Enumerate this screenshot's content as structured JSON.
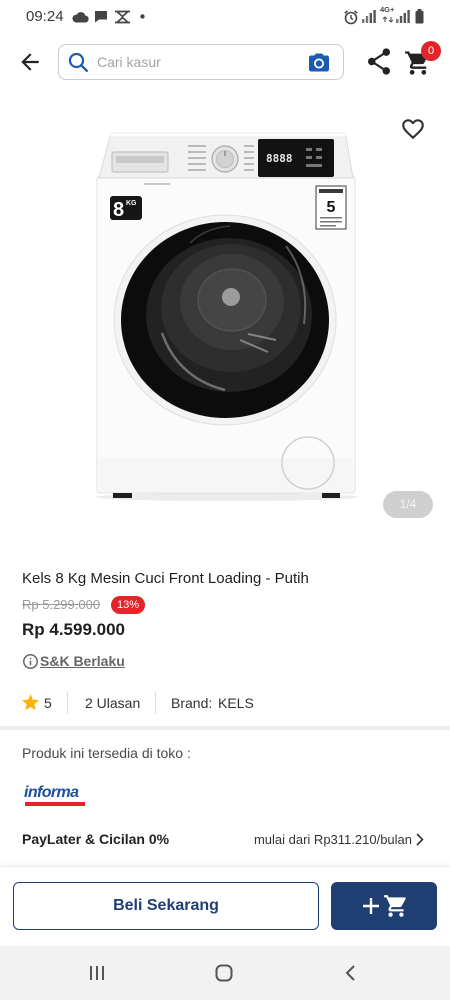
{
  "status_bar": {
    "time": "09:24",
    "network_type": "4G+",
    "icons_left": [
      "cloud-icon",
      "message-icon",
      "app-notification-icon",
      "dot-icon"
    ],
    "icons_right": [
      "alarm-icon",
      "signal-icon",
      "signal-4g-icon",
      "battery-icon"
    ]
  },
  "header": {
    "search": {
      "placeholder": "Cari kasur"
    },
    "cart_count": "0",
    "icons": {
      "back": "back-arrow-icon",
      "search": "search-icon",
      "camera": "camera-icon",
      "share": "share-icon",
      "cart": "cart-icon"
    }
  },
  "gallery": {
    "counter": "1/4",
    "wishlist_icon": "heart-outline-icon",
    "image_text": {
      "capacity_number": "8",
      "capacity_unit": "KG",
      "display_digits": "8888",
      "energy_rating": "5"
    }
  },
  "product": {
    "title": "Kels 8 Kg Mesin Cuci Front Loading - Putih",
    "original_price": "Rp 5.299.000",
    "discount": "13%",
    "price": "Rp 4.599.000",
    "terms_link": "S&K Berlaku",
    "terms_icon": "info-icon"
  },
  "rating": {
    "icon": "star-icon",
    "score": "5",
    "reviews": "2 Ulasan",
    "brand_label": "Brand:",
    "brand_value": "KELS"
  },
  "store": {
    "heading": "Produk ini tersedia di toko :",
    "logo_text": "informa"
  },
  "installment": {
    "label": "PayLater & Cicilan 0%",
    "starting_from": "mulai dari Rp311.210/bulan",
    "icon": "chevron-right-icon"
  },
  "actions": {
    "buy_now": "Beli Sekarang",
    "add_to_cart_icons": [
      "plus-icon",
      "cart-icon"
    ]
  },
  "nav_bar": {
    "icons": [
      "recents-icon",
      "home-icon",
      "back-icon"
    ]
  },
  "colors": {
    "primary": "#1f3f73",
    "link_blue": "#1d5bb0",
    "badge_red": "#e3242b",
    "star_yellow": "#f6b40e",
    "muted_text": "#9a9a9a"
  }
}
